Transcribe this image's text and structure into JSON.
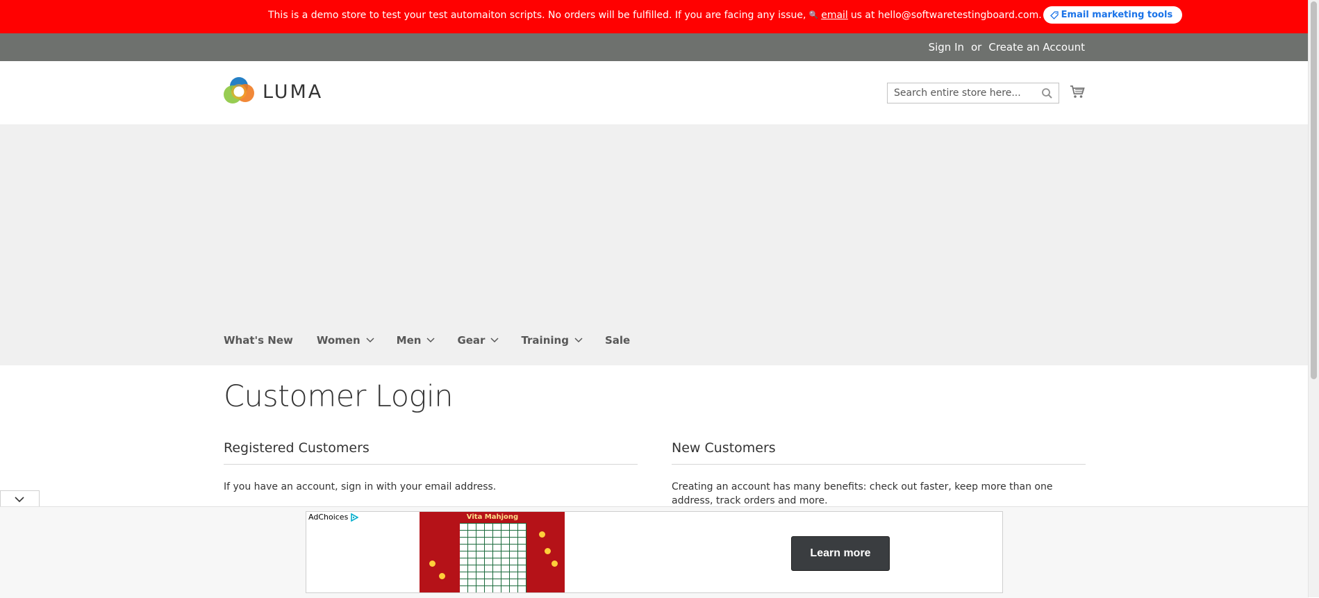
{
  "demo_notice": {
    "text_before": "This is a demo store to test your test automaiton scripts. No orders will be fulfilled. If you are facing any issue,",
    "email_link": "email",
    "text_after": "us at hello@softwaretestingboard.com.",
    "tools_button": "Email marketing tools"
  },
  "header_links": {
    "sign_in": "Sign In",
    "or": "or",
    "create_account": "Create an Account"
  },
  "logo": {
    "text": "LUMA"
  },
  "search": {
    "placeholder": "Search entire store here..."
  },
  "nav": {
    "items": [
      {
        "label": "What's New",
        "dropdown": false
      },
      {
        "label": "Women",
        "dropdown": true
      },
      {
        "label": "Men",
        "dropdown": true
      },
      {
        "label": "Gear",
        "dropdown": true
      },
      {
        "label": "Training",
        "dropdown": true
      },
      {
        "label": "Sale",
        "dropdown": false
      }
    ]
  },
  "page": {
    "title": "Customer Login",
    "registered": {
      "heading": "Registered Customers",
      "text": "If you have an account, sign in with your email address."
    },
    "new_customers": {
      "heading": "New Customers",
      "text": "Creating an account has many benefits: check out faster, keep more than one address, track orders and more."
    }
  },
  "ad": {
    "adchoices": "AdChoices",
    "image_title": "Vita Mahjong",
    "cta": "Learn more"
  },
  "colors": {
    "notice_bg": "#ff0101",
    "panel_bg": "#6e716e",
    "banner_bg": "#f0f0f0",
    "cta_bg": "#3a3d40",
    "link_blue": "#1a73e8"
  }
}
